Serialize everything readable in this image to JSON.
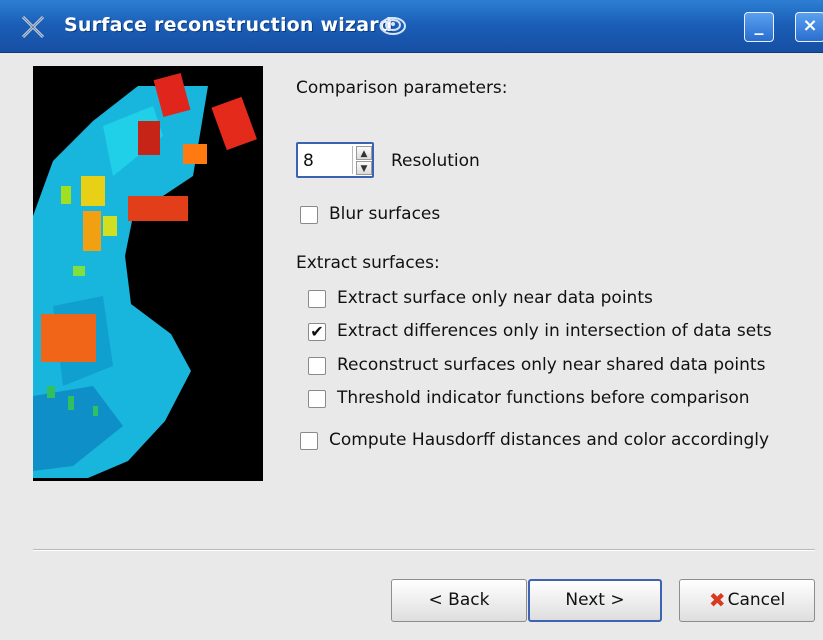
{
  "window": {
    "title": "Surface reconstruction wizard",
    "minimize_label": "_",
    "close_label": "×"
  },
  "params": {
    "heading": "Comparison parameters:",
    "resolution_value": "8",
    "resolution_label": "Resolution",
    "blur_label": "Blur surfaces",
    "blur_checked": false
  },
  "extract": {
    "heading": "Extract surfaces:",
    "options": [
      {
        "label": "Extract surface only near data points",
        "checked": false
      },
      {
        "label": "Extract differences only in intersection of data sets",
        "checked": true,
        "mark": "✔"
      },
      {
        "label": "Reconstruct surfaces only near shared data points",
        "checked": false
      },
      {
        "label": "Threshold indicator functions before comparison",
        "checked": false
      }
    ]
  },
  "hausdorff": {
    "label": "Compute Hausdorff distances and color accordingly",
    "checked": false
  },
  "buttons": {
    "back_label": "< Back",
    "next_label": "Next >",
    "cancel_label": "Cancel"
  }
}
